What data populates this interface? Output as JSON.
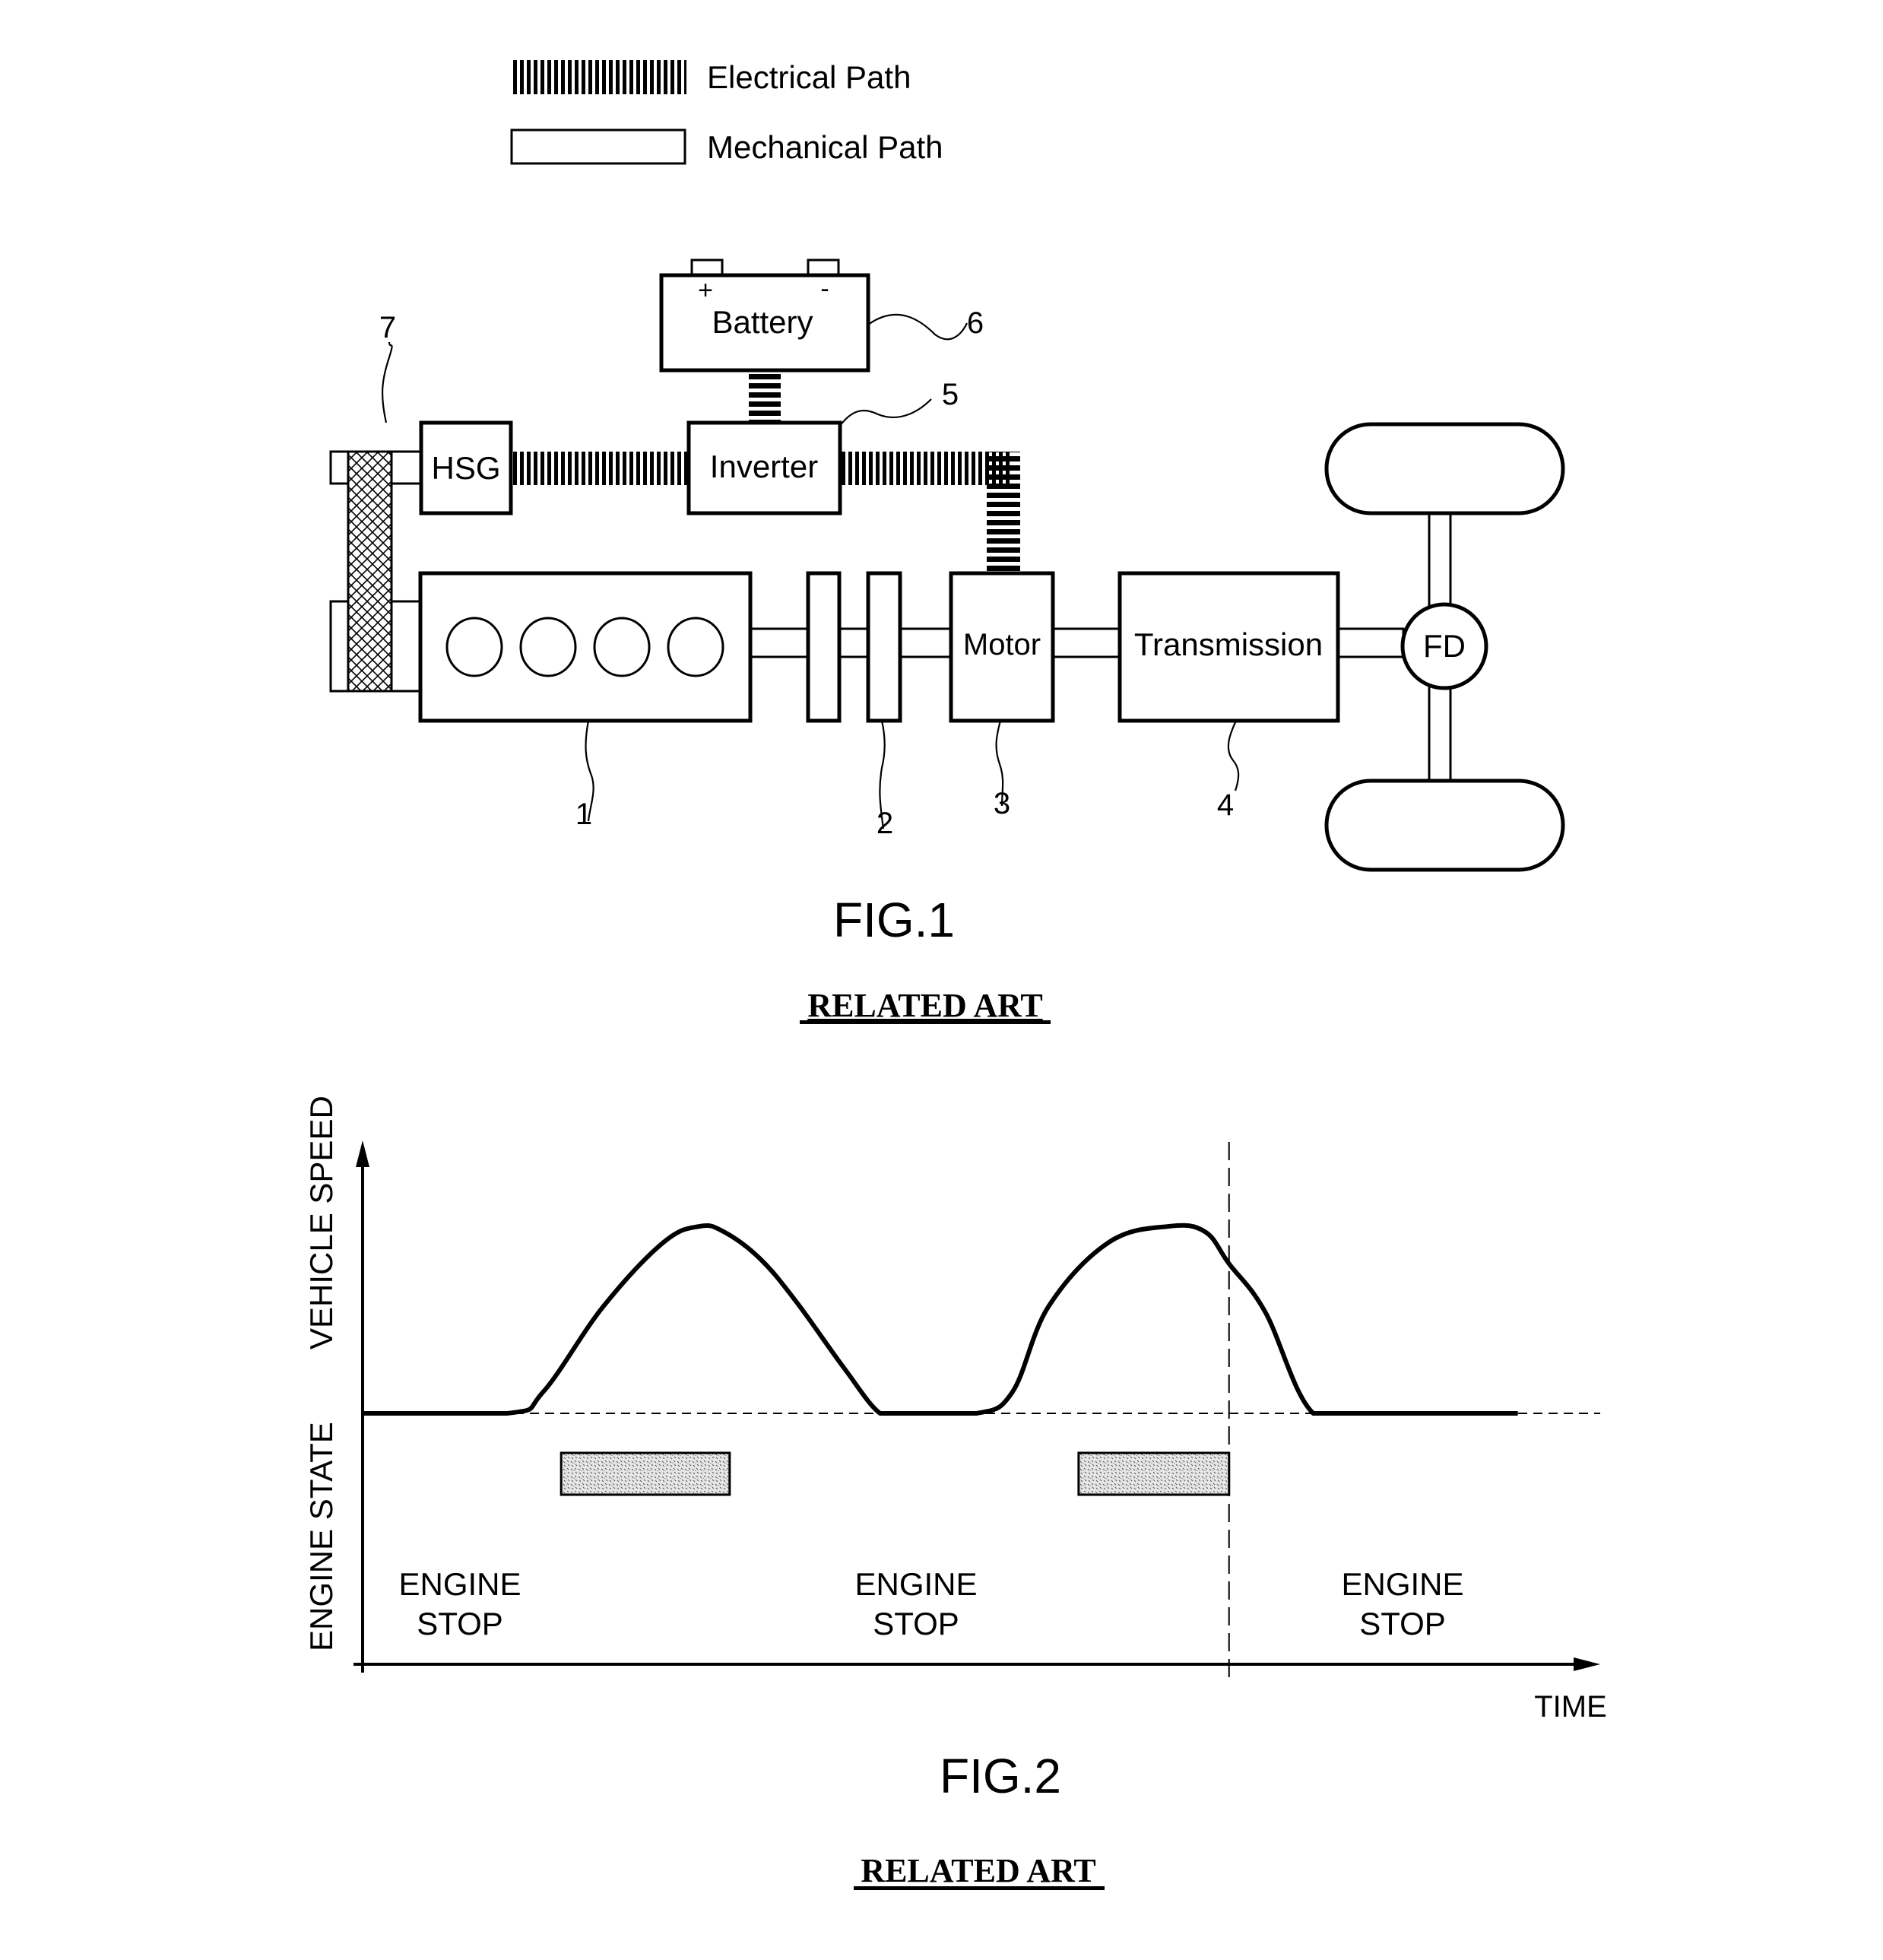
{
  "legend": {
    "electrical_label": "Electrical Path",
    "mechanical_label": "Mechanical Path"
  },
  "fig1": {
    "components": {
      "battery": {
        "label": "Battery",
        "ref": "6",
        "plus": "+",
        "minus": "-"
      },
      "hsg": {
        "label": "HSG",
        "ref": "7"
      },
      "inverter": {
        "label": "Inverter",
        "ref": "5"
      },
      "engine": {
        "ref": "1"
      },
      "clutch": {
        "ref": "2"
      },
      "motor": {
        "label": "Motor",
        "ref": "3"
      },
      "transmission": {
        "label": "Transmission",
        "ref": "4"
      },
      "final_drive": {
        "label": "FD"
      }
    },
    "caption": "FIG.1",
    "note": "RELATED ART"
  },
  "fig2": {
    "caption": "FIG.2",
    "note": "RELATED ART",
    "chart_data": {
      "type": "line",
      "title": "",
      "xlabel": "TIME",
      "ylabel_upper": "VEHICLE SPEED",
      "ylabel_lower": "ENGINE STATE",
      "x_range": [
        0,
        100
      ],
      "y_range": [
        0,
        100
      ],
      "grid": false,
      "speed_profile": {
        "name": "Vehicle speed",
        "x": [
          0,
          12,
          15,
          20,
          25,
          28,
          30,
          33,
          36,
          40,
          43,
          45,
          51,
          54,
          57,
          62,
          67,
          70,
          72,
          75,
          79,
          84,
          96
        ],
        "y": [
          0,
          0,
          8,
          40,
          64,
          70,
          68,
          58,
          42,
          17,
          0,
          0,
          0,
          8,
          40,
          64,
          70,
          68,
          56,
          38,
          0,
          0,
          0
        ]
      },
      "engine_on_intervals": [
        {
          "start": 16.5,
          "end": 30.5
        },
        {
          "start": 59.5,
          "end": 72
        }
      ],
      "reference_lines": {
        "horizontal_dashed": "speed = 0 baseline",
        "vertical_dashed_x": 72
      },
      "annotations": [
        {
          "line1": "ENGINE",
          "line2": "STOP",
          "region": "left"
        },
        {
          "line1": "ENGINE",
          "line2": "STOP",
          "region": "middle"
        },
        {
          "line1": "ENGINE",
          "line2": "STOP",
          "region": "right"
        }
      ]
    }
  }
}
